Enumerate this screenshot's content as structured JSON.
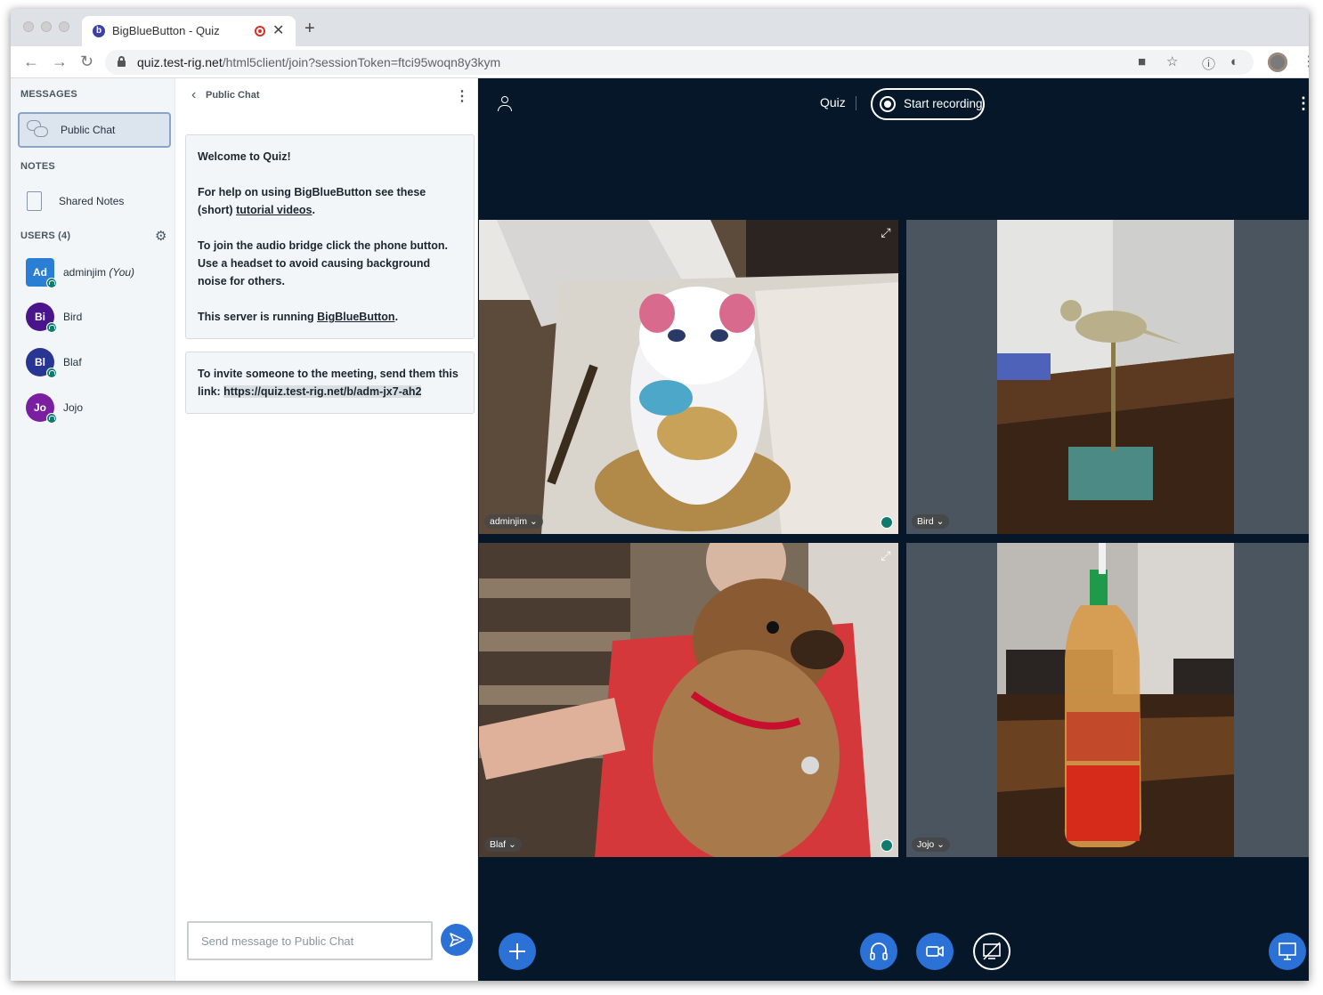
{
  "browser": {
    "tab_title": "BigBlueButton - Quiz",
    "url_host": "quiz.test-rig.net",
    "url_path": "/html5client/join?sessionToken=ftci95woqn8y3kym"
  },
  "sidebar": {
    "messages_heading": "MESSAGES",
    "public_chat_label": "Public Chat",
    "notes_heading": "NOTES",
    "shared_notes_label": "Shared Notes",
    "users_heading": "USERS (4)",
    "users": [
      {
        "initials": "Ad",
        "name": "adminjim",
        "suffix": "(You)",
        "color": "#2a7fd4"
      },
      {
        "initials": "Bi",
        "name": "Bird",
        "suffix": "",
        "color": "#4a148c"
      },
      {
        "initials": "Bl",
        "name": "Blaf",
        "suffix": "",
        "color": "#283593"
      },
      {
        "initials": "Jo",
        "name": "Jojo",
        "suffix": "",
        "color": "#7b1fa2"
      }
    ]
  },
  "chat": {
    "title": "Public Chat",
    "welcome_prefix": "Welcome to ",
    "welcome_meeting": "Quiz",
    "welcome_suffix": "!",
    "help_prefix": "For help on using BigBlueButton see these (short) ",
    "help_link": "tutorial videos",
    "help_suffix": ".",
    "audio_line": "To join the audio bridge click the phone button. Use a headset to avoid causing background noise for others.",
    "server_prefix": "This server is running ",
    "server_link": "BigBlueButton",
    "server_suffix": ".",
    "invite_text": "To invite someone to the meeting, send them this link: ",
    "invite_link": "https://quiz.test-rig.net/b/adm-jx7-ah2",
    "input_placeholder": "Send message to Public Chat"
  },
  "meeting": {
    "title": "Quiz",
    "record_label": "Start recording"
  },
  "videos": [
    {
      "name": "adminjim"
    },
    {
      "name": "Bird"
    },
    {
      "name": "Blaf"
    },
    {
      "name": "Jojo"
    }
  ],
  "colors": {
    "accent": "#2c71d6",
    "media_bg": "#06172a",
    "sidebar_bg": "#f3f6f9"
  }
}
